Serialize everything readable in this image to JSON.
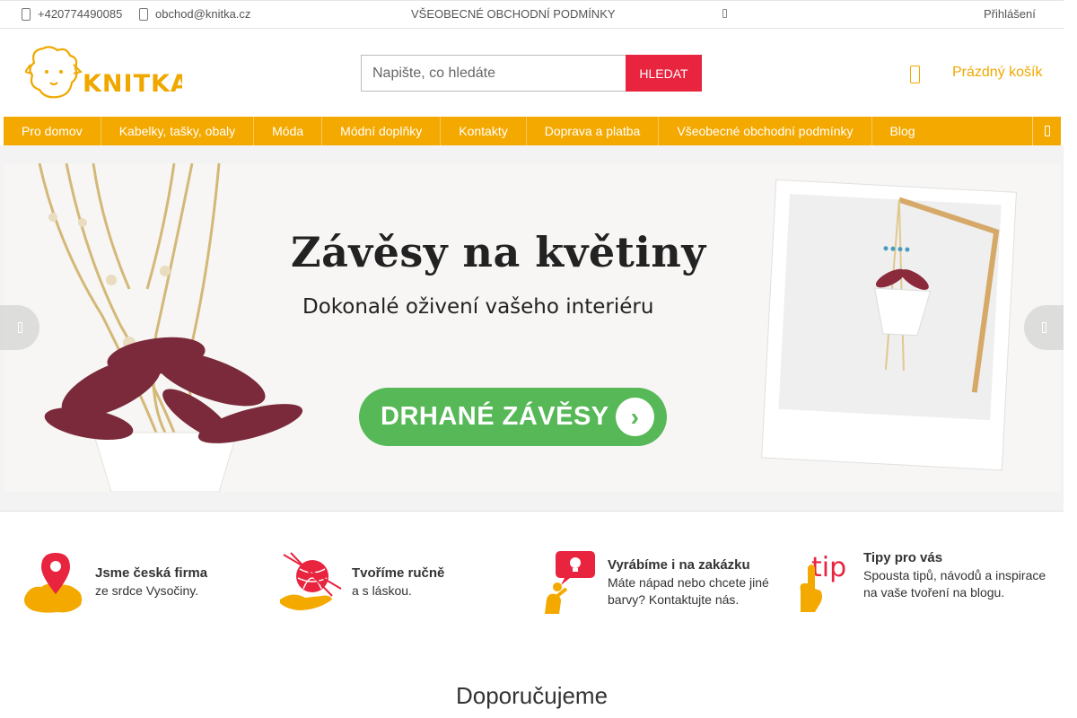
{
  "topbar": {
    "phone": "+420774490085",
    "email": "obchod@knitka.cz",
    "terms_link": "VŠEOBECNÉ OBCHODNÍ PODMÍNKY",
    "login": "Přihlášení"
  },
  "header": {
    "logo_text": "KNITKA",
    "search_placeholder": "Napište, co hledáte",
    "search_button": "HLEDAT",
    "cart_label": "Prázdný košík"
  },
  "nav": {
    "items": [
      {
        "label": "Pro domov"
      },
      {
        "label": "Kabelky, tašky, obaly"
      },
      {
        "label": "Móda"
      },
      {
        "label": "Módní doplňky"
      },
      {
        "label": "Kontakty"
      },
      {
        "label": "Doprava a platba"
      },
      {
        "label": "Všeobecné obchodní podmínky"
      },
      {
        "label": "Blog"
      }
    ]
  },
  "banner": {
    "headline": "Závěsy na květiny",
    "subheadline": "Dokonalé oživení vašeho interiéru",
    "cta": "DRHANÉ ZÁVĚSY"
  },
  "features": [
    {
      "title": "Jsme česká firma",
      "text": "ze srdce Vysočiny.",
      "icon": "map-pin-icon"
    },
    {
      "title": "Tvoříme ručně",
      "text": "a s láskou.",
      "icon": "yarn-hand-icon"
    },
    {
      "title": "Vyrábíme i na zakázku",
      "text": "Máte nápad nebo chcete jiné barvy? Kontaktujte nás.",
      "icon": "idea-person-icon"
    },
    {
      "title": "Tipy pro vás",
      "text": "Spousta tipů, návodů a inspirace na vaše tvoření na blogu.",
      "icon": "tip-hand-icon"
    }
  ],
  "section_title": "Doporučujeme",
  "colors": {
    "accent": "#f4a900",
    "search_button": "#e8243f",
    "cta": "#56b856"
  }
}
